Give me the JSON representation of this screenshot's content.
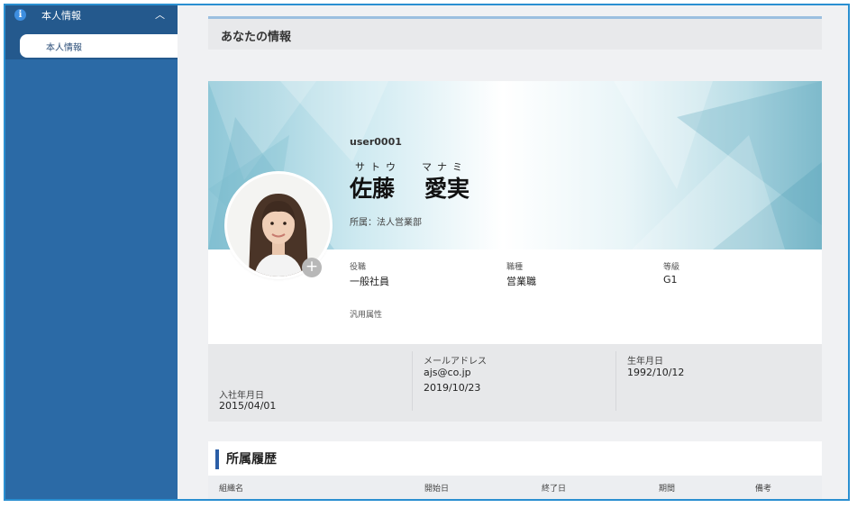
{
  "sidebar": {
    "section_title": "本人情報",
    "items": [
      {
        "label": "本人情報"
      }
    ]
  },
  "header": {
    "title": "あなたの情報"
  },
  "profile": {
    "user_id": "user0001",
    "kana_sei": "サトウ",
    "kana_mei": "マナミ",
    "name_sei": "佐藤",
    "name_mei": "愛実",
    "affiliation": "所属：法人営業部",
    "attributes": [
      {
        "label": "役職",
        "value": "一般社員"
      },
      {
        "label": "職種",
        "value": "営業職"
      },
      {
        "label": "等級",
        "value": "G1"
      }
    ],
    "general_attr_label": "汎用属性"
  },
  "details": {
    "join_label": "入社年月日",
    "join_value": "2015/04/01",
    "email_label": "メールアドレス",
    "email_value": "ajs@co.jp",
    "email_date": "2019/10/23",
    "birth_label": "生年月日",
    "birth_value": "1992/10/12"
  },
  "history": {
    "title": "所属履歴",
    "columns": [
      "組織名",
      "開始日",
      "終了日",
      "期間",
      "備考"
    ]
  },
  "colors": {
    "sidebar": "#2b6aa6",
    "sidebar_section": "#24598d",
    "accent": "#2b5ea6",
    "frame_border": "#2a8fd1"
  }
}
